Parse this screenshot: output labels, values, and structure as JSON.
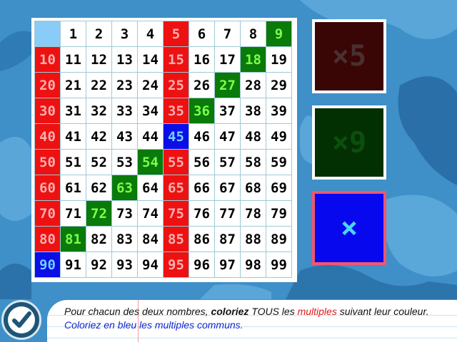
{
  "colors": {
    "background": "#3f8fc8",
    "multiple_5": "#ee1111",
    "multiple_9": "#0a7a0a",
    "common": "#0d0de8"
  },
  "grid": {
    "header": [
      "1",
      "2",
      "3",
      "4",
      "5",
      "6",
      "7",
      "8",
      "9"
    ],
    "red_cells": [
      5,
      10,
      15,
      20,
      25,
      30,
      35,
      40,
      50,
      55,
      60,
      65,
      70,
      75,
      80,
      85,
      95
    ],
    "green_cells": [
      9,
      18,
      27,
      36,
      54,
      63,
      72,
      81
    ],
    "blue_cells": [
      45,
      90
    ]
  },
  "buttons": {
    "times5": "×5",
    "times9": "×9",
    "both": "×"
  },
  "instruction": {
    "part1": "Pour chacun des deux nombres, ",
    "bold": "coloriez",
    "part2": " TOUS les ",
    "multiples": "multiples",
    "part3": " suivant leur couleur. ",
    "blue_text": "Coloriez en bleu les multiples communs."
  },
  "icons": {
    "check": "check-icon"
  }
}
